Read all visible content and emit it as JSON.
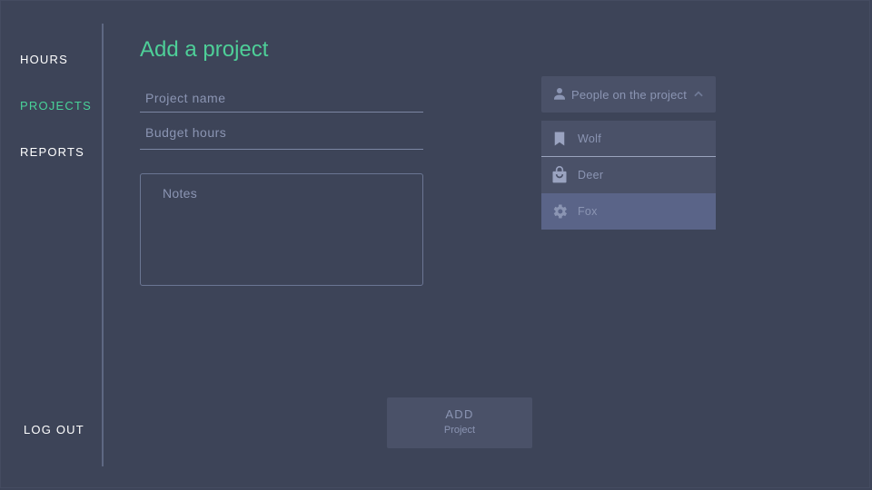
{
  "nav": {
    "hours": "HOURS",
    "projects": "PROJECTS",
    "reports": "REPORTS",
    "logout": "LOG OUT",
    "active": "projects"
  },
  "page": {
    "title": "Add a project"
  },
  "form": {
    "project_name_placeholder": "Project name",
    "budget_hours_placeholder": "Budget hours",
    "notes_placeholder": "Notes"
  },
  "people_dropdown": {
    "label": "People on the project",
    "expanded": true,
    "items": [
      {
        "label": "Wolf",
        "icon": "bookmark-icon"
      },
      {
        "label": "Deer",
        "icon": "shopping-bag-icon"
      },
      {
        "label": "Fox",
        "icon": "gear-icon",
        "highlighted": true
      }
    ]
  },
  "add_button": {
    "label": "ADD",
    "sublabel": "Project"
  },
  "colors": {
    "background": "#3d4458",
    "accent": "#49d399",
    "panel": "#4a5168",
    "highlight": "#5a6488",
    "muted_text": "#8b95b3"
  }
}
